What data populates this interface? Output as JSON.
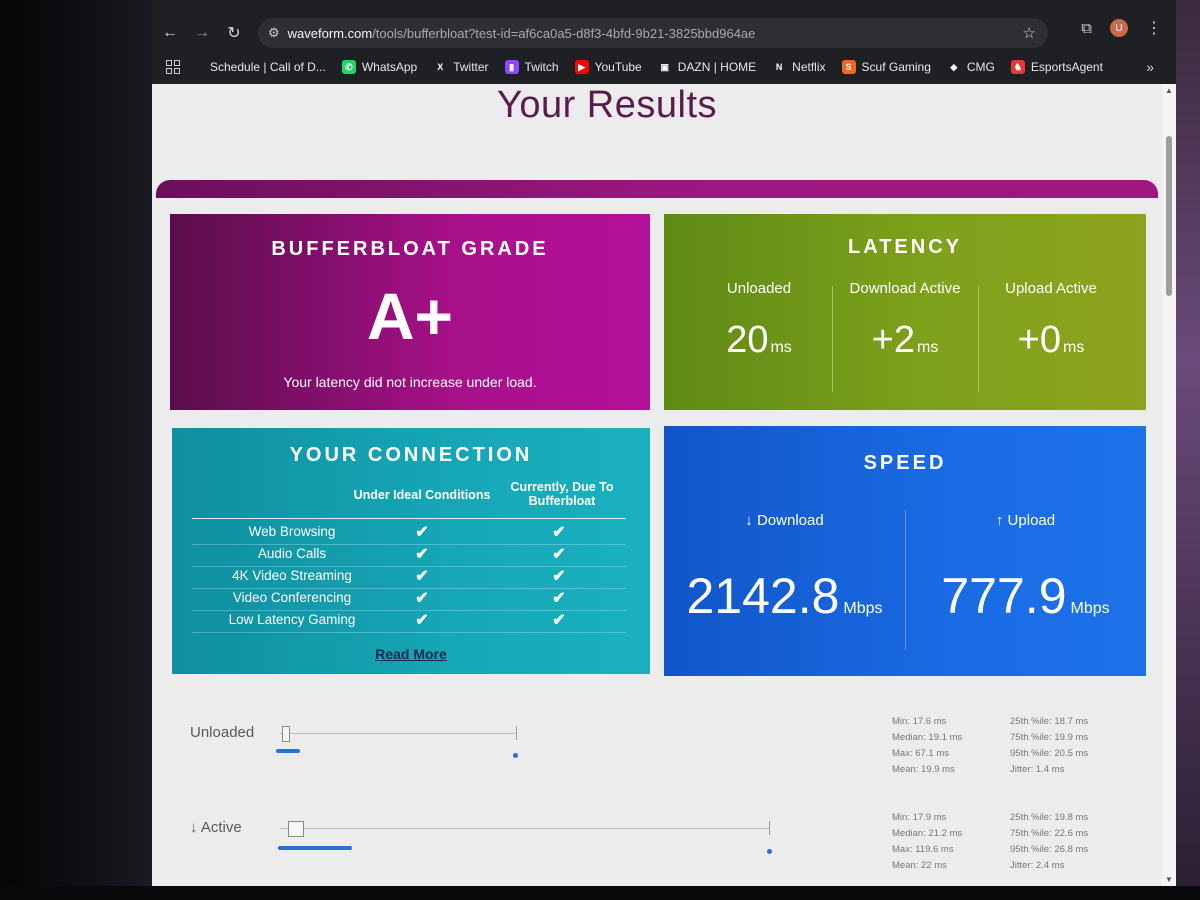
{
  "browser": {
    "url_host": "waveform.com",
    "url_path": "/tools/bufferbloat?test-id=af6ca0a5-d8f3-4bfd-9b21-3825bbd964ae",
    "profile_initial": "U",
    "bookmarks": [
      {
        "label": "Schedule | Call of D...",
        "color": "#1f2024",
        "glyph": ""
      },
      {
        "label": "WhatsApp",
        "color": "#25d366",
        "glyph": "✆"
      },
      {
        "label": "Twitter",
        "color": "#1f2024",
        "glyph": "X"
      },
      {
        "label": "Twitch",
        "color": "#9146ff",
        "glyph": "▮"
      },
      {
        "label": "YouTube",
        "color": "#ff0000",
        "glyph": "▶"
      },
      {
        "label": "DAZN | HOME",
        "color": "#1f2024",
        "glyph": "▣"
      },
      {
        "label": "Netflix",
        "color": "#1f2024",
        "glyph": "N"
      },
      {
        "label": "Scuf Gaming",
        "color": "#f26522",
        "glyph": "S"
      },
      {
        "label": "CMG",
        "color": "#1f2024",
        "glyph": "◆"
      },
      {
        "label": "EsportsAgent",
        "color": "#e53935",
        "glyph": "♞"
      }
    ]
  },
  "page": {
    "title": "Your Results",
    "grade": {
      "title": "BUFFERBLOAT GRADE",
      "value": "A+",
      "description": "Your latency did not increase under load."
    },
    "latency": {
      "title": "LATENCY",
      "columns": [
        {
          "label": "Unloaded",
          "value": "20",
          "unit": "ms"
        },
        {
          "label": "Download Active",
          "value": "+2",
          "unit": "ms"
        },
        {
          "label": "Upload Active",
          "value": "+0",
          "unit": "ms"
        }
      ]
    },
    "connection": {
      "title": "YOUR CONNECTION",
      "col_ideal": "Under Ideal Conditions",
      "col_current": "Currently, Due To Bufferbloat",
      "rows": [
        {
          "name": "Web Browsing",
          "ideal": "✔",
          "current": "✔"
        },
        {
          "name": "Audio Calls",
          "ideal": "✔",
          "current": "✔"
        },
        {
          "name": "4K Video Streaming",
          "ideal": "✔",
          "current": "✔"
        },
        {
          "name": "Video Conferencing",
          "ideal": "✔",
          "current": "✔"
        },
        {
          "name": "Low Latency Gaming",
          "ideal": "✔",
          "current": "✔"
        }
      ],
      "read_more": "Read More"
    },
    "speed": {
      "title": "SPEED",
      "download": {
        "label": "↓ Download",
        "value": "2142.8",
        "unit": "Mbps"
      },
      "upload": {
        "label": "↑ Upload",
        "value": "777.9",
        "unit": "Mbps"
      }
    },
    "latency_details": [
      {
        "label": "Unloaded",
        "stats_left": [
          "Min: 17.6 ms",
          "Median: 19.1 ms",
          "Max: 67.1 ms",
          "Mean: 19.9 ms"
        ],
        "stats_right": [
          "25th %ile: 18.7 ms",
          "75th %ile: 19.9 ms",
          "95th %ile: 20.5 ms",
          "Jitter: 1.4 ms"
        ]
      },
      {
        "label": "↓ Active",
        "stats_left": [
          "Min: 17.9 ms",
          "Median: 21.2 ms",
          "Max: 119.6 ms",
          "Mean: 22 ms"
        ],
        "stats_right": [
          "25th %ile: 19.8 ms",
          "75th %ile: 22.6 ms",
          "95th %ile: 26.8 ms",
          "Jitter: 2.4 ms"
        ]
      }
    ]
  }
}
